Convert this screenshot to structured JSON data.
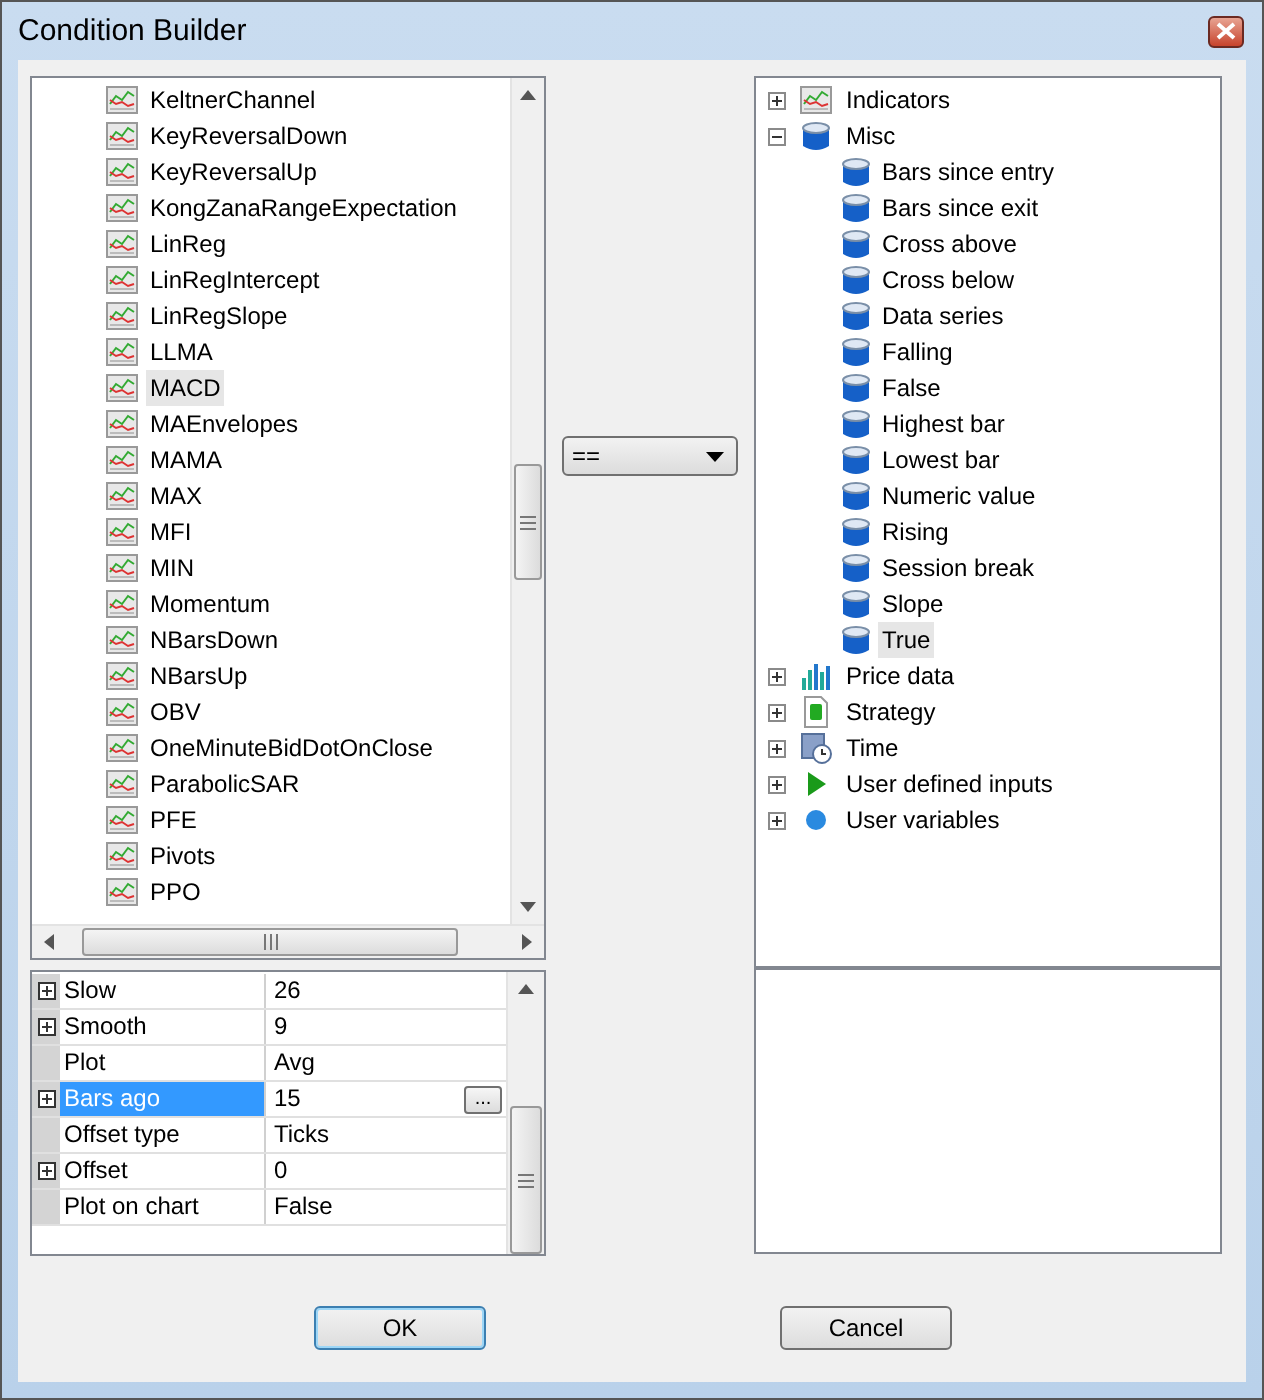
{
  "window": {
    "title": "Condition Builder"
  },
  "indicator_list": {
    "items": [
      {
        "label": "KeltnerChannel",
        "selected": false
      },
      {
        "label": "KeyReversalDown",
        "selected": false
      },
      {
        "label": "KeyReversalUp",
        "selected": false
      },
      {
        "label": "KongZanaRangeExpectation",
        "selected": false
      },
      {
        "label": "LinReg",
        "selected": false
      },
      {
        "label": "LinRegIntercept",
        "selected": false
      },
      {
        "label": "LinRegSlope",
        "selected": false
      },
      {
        "label": "LLMA",
        "selected": false
      },
      {
        "label": "MACD",
        "selected": true
      },
      {
        "label": "MAEnvelopes",
        "selected": false
      },
      {
        "label": "MAMA",
        "selected": false
      },
      {
        "label": "MAX",
        "selected": false
      },
      {
        "label": "MFI",
        "selected": false
      },
      {
        "label": "MIN",
        "selected": false
      },
      {
        "label": "Momentum",
        "selected": false
      },
      {
        "label": "NBarsDown",
        "selected": false
      },
      {
        "label": "NBarsUp",
        "selected": false
      },
      {
        "label": "OBV",
        "selected": false
      },
      {
        "label": "OneMinuteBidDotOnClose",
        "selected": false
      },
      {
        "label": "ParabolicSAR",
        "selected": false
      },
      {
        "label": "PFE",
        "selected": false
      },
      {
        "label": "Pivots",
        "selected": false
      },
      {
        "label": "PPO",
        "selected": false
      }
    ]
  },
  "properties": [
    {
      "name": "Slow",
      "value": "26",
      "expandable": true,
      "selected": false
    },
    {
      "name": "Smooth",
      "value": "9",
      "expandable": true,
      "selected": false
    },
    {
      "name": "Plot",
      "value": "Avg",
      "expandable": false,
      "selected": false
    },
    {
      "name": "Bars ago",
      "value": "15",
      "expandable": true,
      "selected": true,
      "button": "..."
    },
    {
      "name": "Offset type",
      "value": "Ticks",
      "expandable": false,
      "selected": false
    },
    {
      "name": "Offset",
      "value": "0",
      "expandable": true,
      "selected": false
    },
    {
      "name": "Plot on chart",
      "value": "False",
      "expandable": false,
      "selected": false
    }
  ],
  "operator": {
    "value": "=="
  },
  "tree": [
    {
      "label": "Indicators",
      "kind": "indicator",
      "expanded": false,
      "selected": false
    },
    {
      "label": "Misc",
      "kind": "misc",
      "expanded": true,
      "selected": false,
      "children": [
        {
          "label": "Bars since entry",
          "kind": "misc",
          "selected": false
        },
        {
          "label": "Bars since exit",
          "kind": "misc",
          "selected": false
        },
        {
          "label": "Cross above",
          "kind": "misc",
          "selected": false
        },
        {
          "label": "Cross below",
          "kind": "misc",
          "selected": false
        },
        {
          "label": "Data series",
          "kind": "misc",
          "selected": false
        },
        {
          "label": "Falling",
          "kind": "misc",
          "selected": false
        },
        {
          "label": "False",
          "kind": "misc",
          "selected": false
        },
        {
          "label": "Highest bar",
          "kind": "misc",
          "selected": false
        },
        {
          "label": "Lowest bar",
          "kind": "misc",
          "selected": false
        },
        {
          "label": "Numeric value",
          "kind": "misc",
          "selected": false
        },
        {
          "label": "Rising",
          "kind": "misc",
          "selected": false
        },
        {
          "label": "Session break",
          "kind": "misc",
          "selected": false
        },
        {
          "label": "Slope",
          "kind": "misc",
          "selected": false
        },
        {
          "label": "True",
          "kind": "misc",
          "selected": true
        }
      ]
    },
    {
      "label": "Price data",
      "kind": "price",
      "expanded": false,
      "selected": false
    },
    {
      "label": "Strategy",
      "kind": "strategy",
      "expanded": false,
      "selected": false
    },
    {
      "label": "Time",
      "kind": "time",
      "expanded": false,
      "selected": false
    },
    {
      "label": "User defined inputs",
      "kind": "input",
      "expanded": false,
      "selected": false
    },
    {
      "label": "User variables",
      "kind": "variable",
      "expanded": false,
      "selected": false
    }
  ],
  "buttons": [
    {
      "label": "OK",
      "default": true
    },
    {
      "label": "Cancel",
      "default": false
    }
  ]
}
